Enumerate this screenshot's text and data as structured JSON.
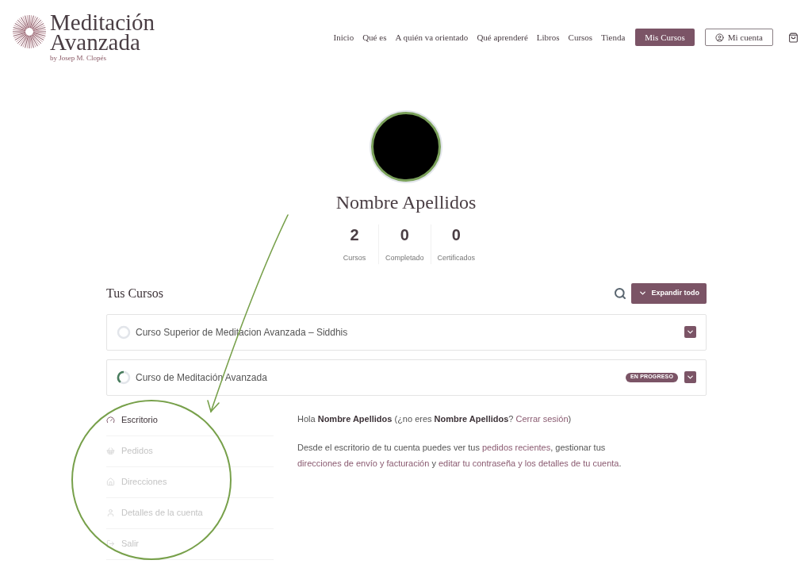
{
  "logo": {
    "line1": "Meditación",
    "line2": "Avanzada",
    "byline": "by Josep M. Clopés"
  },
  "nav": [
    {
      "label": "Inicio",
      "kind": "link"
    },
    {
      "label": "Qué es",
      "kind": "link"
    },
    {
      "label": "A quién va orientado",
      "kind": "link"
    },
    {
      "label": "Qué aprenderé",
      "kind": "link"
    },
    {
      "label": "Libros",
      "kind": "link"
    },
    {
      "label": "Cursos",
      "kind": "link"
    },
    {
      "label": "Tienda",
      "kind": "link"
    },
    {
      "label": "Mis Cursos",
      "kind": "primary"
    },
    {
      "label": "Mi cuenta",
      "kind": "account"
    }
  ],
  "profile": {
    "name": "Nombre Apellidos",
    "stats": [
      {
        "value": "2",
        "label": "Cursos"
      },
      {
        "value": "0",
        "label": "Completado"
      },
      {
        "value": "0",
        "label": "Certificados"
      }
    ]
  },
  "courses": {
    "title": "Tus Cursos",
    "expand_button": "Expandir todo",
    "items": [
      {
        "title": "Curso Superior de Meditacion Avanzada – Siddhis"
      },
      {
        "title": "Curso de Meditación Avanzada",
        "level": 0.4,
        "badge": "EN PROGRESO"
      }
    ]
  },
  "account_nav": [
    {
      "label": "Escritorio",
      "kind": "dashboard",
      "selected": true
    },
    {
      "label": "Pedidos",
      "kind": "orders",
      "selected": false
    },
    {
      "label": "Direcciones",
      "kind": "addresses",
      "selected": false
    },
    {
      "label": "Detalles de la cuenta",
      "kind": "account",
      "selected": false
    },
    {
      "label": "Salir",
      "kind": "logout",
      "selected": false
    }
  ],
  "greeting": [
    {
      "text": "Hola ",
      "kind": "plain"
    },
    {
      "text": "Nombre Apellidos",
      "kind": "bold"
    },
    {
      "text": " (¿no eres ",
      "kind": "plain"
    },
    {
      "text": "Nombre Apellidos",
      "kind": "bold"
    },
    {
      "text": "? ",
      "kind": "plain"
    },
    {
      "text": "Cerrar sesión",
      "kind": "link"
    },
    {
      "text": ")",
      "kind": "plain"
    }
  ],
  "intro": [
    {
      "text": "Desde el escritorio de tu cuenta puedes ver tus ",
      "kind": "plain"
    },
    {
      "text": "pedidos recientes",
      "kind": "link"
    },
    {
      "text": ", gestionar tus ",
      "kind": "plain"
    },
    {
      "text": "direcciones de envío y facturación",
      "kind": "link"
    },
    {
      "text": " y ",
      "kind": "plain"
    },
    {
      "text": "editar tu contraseña y los detalles de tu cuenta",
      "kind": "link"
    },
    {
      "text": ".",
      "kind": "plain"
    }
  ]
}
